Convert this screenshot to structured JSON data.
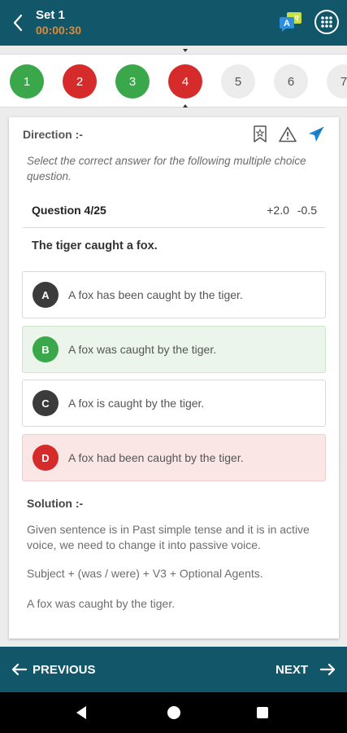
{
  "header": {
    "title": "Set 1",
    "timer": "00:00:30",
    "translate_badge_letters": [
      "A",
      "ए"
    ]
  },
  "question_strip": {
    "items": [
      {
        "label": "1",
        "state": "correct"
      },
      {
        "label": "2",
        "state": "wrong"
      },
      {
        "label": "3",
        "state": "correct"
      },
      {
        "label": "4",
        "state": "wrong"
      },
      {
        "label": "5",
        "state": "pending"
      },
      {
        "label": "6",
        "state": "pending"
      },
      {
        "label": "7",
        "state": "pending"
      }
    ],
    "current": "4"
  },
  "card": {
    "direction_label": "Direction :-",
    "direction_text": "Select the correct answer for the following multiple choice question.",
    "question_number": "Question 4/25",
    "marks_positive": "+2.0",
    "marks_negative": "-0.5",
    "question_text": "The tiger caught a fox.",
    "options": [
      {
        "letter": "A",
        "text": "A fox has been caught by the tiger.",
        "state": "neutral"
      },
      {
        "letter": "B",
        "text": "A fox was caught by the tiger.",
        "state": "correct"
      },
      {
        "letter": "C",
        "text": "A fox is caught by the tiger.",
        "state": "neutral"
      },
      {
        "letter": "D",
        "text": "A fox had been caught by the tiger.",
        "state": "wrong"
      }
    ],
    "solution_label": "Solution :-",
    "solution_paragraphs": [
      "Given sentence is in Past simple tense and it is in active voice, we need to change it into passive voice.",
      "Subject + (was / were) + V3 + Optional Agents.",
      "A fox was caught by the tiger."
    ]
  },
  "footer": {
    "previous_label": "PREVIOUS",
    "next_label": "NEXT"
  },
  "colors": {
    "primary": "#12566a",
    "timer": "#e4882f",
    "correct": "#3aa84a",
    "wrong": "#d62b2b",
    "send_icon": "#1e88d6"
  },
  "icons": {
    "back": "arrow-left-icon",
    "translate": "translate-icon",
    "grid": "grid-icon",
    "bookmark": "bookmark-star-icon",
    "report": "warning-icon",
    "share": "send-icon"
  }
}
